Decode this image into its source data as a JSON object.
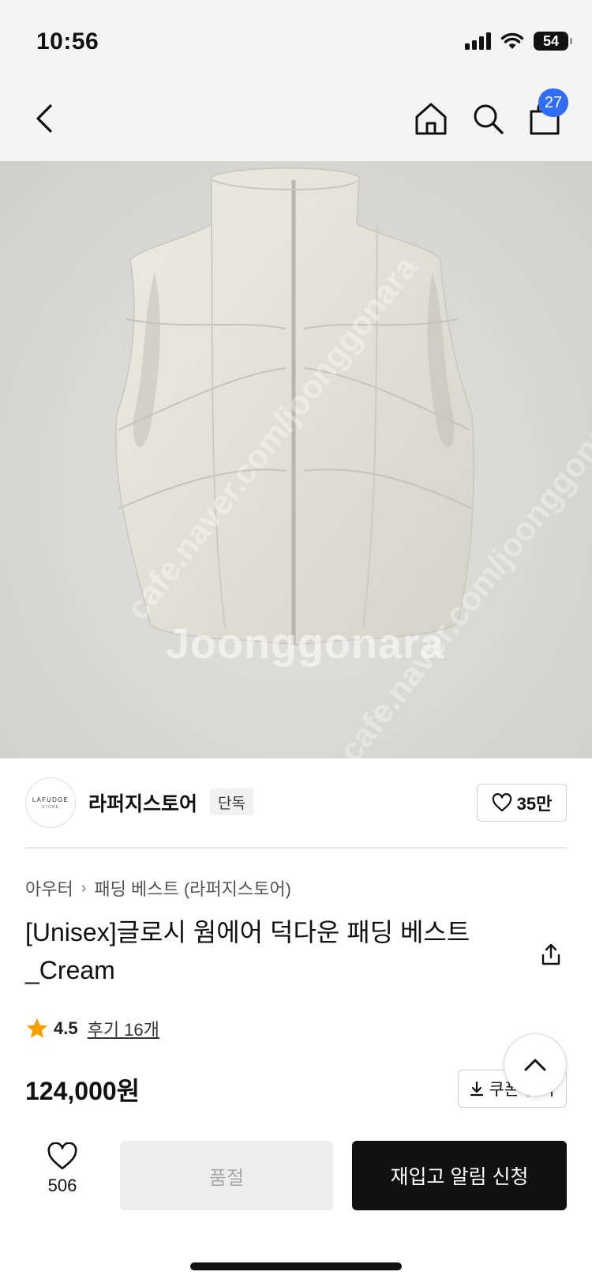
{
  "status_bar": {
    "time": "10:56",
    "battery": "54"
  },
  "nav": {
    "cart_count": "27"
  },
  "hero": {
    "watermark": "Joonggonara",
    "watermark_diag_1": "cafe.naver.com/joonggonara",
    "watermark_diag_2": "cafe.naver.com/joonggonara"
  },
  "store": {
    "logo_text": "LAFUDGE",
    "logo_subtext": "STORE",
    "name": "라퍼지스토어",
    "tag": "단독",
    "likes": "35만"
  },
  "product": {
    "breadcrumb": [
      "아우터",
      "패딩 베스트 (라퍼지스토어)"
    ],
    "title": "[Unisex]글로시 웜에어 덕다운 패딩 베스트_Cream",
    "rating": "4.5",
    "review_link": "후기 16개",
    "price": "124,000원",
    "coupon_label": "쿠폰 받기"
  },
  "bottom_bar": {
    "wish_count": "506",
    "soldout_label": "품절",
    "restock_label": "재입고 알림 신청"
  },
  "colors": {
    "badge": "#2f6df6",
    "star": "#f5a000",
    "primary_button": "#111111"
  }
}
